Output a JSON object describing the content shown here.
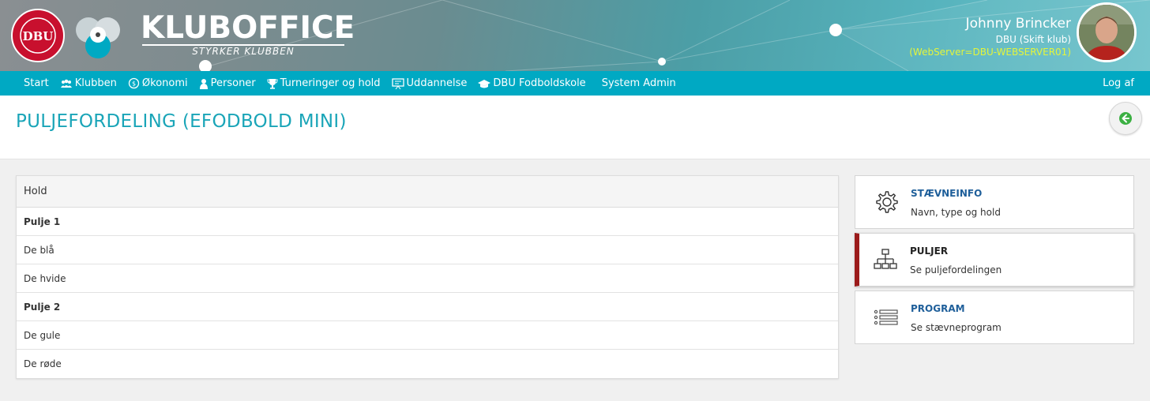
{
  "header": {
    "brand_title": "KLUBOFFICE",
    "brand_subtitle": "STYRKER KLUBBEN",
    "user_name": "Johnny Brincker",
    "user_club": "DBU (Skift klub)",
    "server": "(WebServer=DBU-WEBSERVER01)"
  },
  "nav": {
    "items": [
      {
        "label": "Start",
        "icon": "none"
      },
      {
        "label": "Klubben",
        "icon": "users-icon"
      },
      {
        "label": "Økonomi",
        "icon": "money-icon"
      },
      {
        "label": "Personer",
        "icon": "person-icon"
      },
      {
        "label": "Turneringer og hold",
        "icon": "trophy-icon"
      },
      {
        "label": "Uddannelse",
        "icon": "presentation-icon"
      },
      {
        "label": "DBU Fodboldskole",
        "icon": "graduation-cap-icon"
      },
      {
        "label": "System Admin",
        "icon": "none"
      }
    ],
    "logout": "Log af"
  },
  "page": {
    "title": "PULJEFORDELING (EFODBOLD MINI)"
  },
  "teams": {
    "header": "Hold",
    "rows": [
      {
        "label": "Pulje 1",
        "type": "group"
      },
      {
        "label": "De blå",
        "type": "team"
      },
      {
        "label": "De hvide",
        "type": "team"
      },
      {
        "label": "Pulje 2",
        "type": "group"
      },
      {
        "label": "De gule",
        "type": "team"
      },
      {
        "label": "De røde",
        "type": "team"
      }
    ]
  },
  "cards": [
    {
      "title": "STÆVNEINFO",
      "subtitle": "Navn, type og hold",
      "icon": "gear-icon",
      "active": false
    },
    {
      "title": "PULJER",
      "subtitle": "Se puljefordelingen",
      "icon": "org-chart-icon",
      "active": true
    },
    {
      "title": "PROGRAM",
      "subtitle": "Se stævneprogram",
      "icon": "list-icon",
      "active": false
    }
  ],
  "colors": {
    "accent": "#00a9c3",
    "title": "#1aa5b8",
    "active_marker": "#9b1b1b",
    "server_text": "#e4f53a"
  }
}
